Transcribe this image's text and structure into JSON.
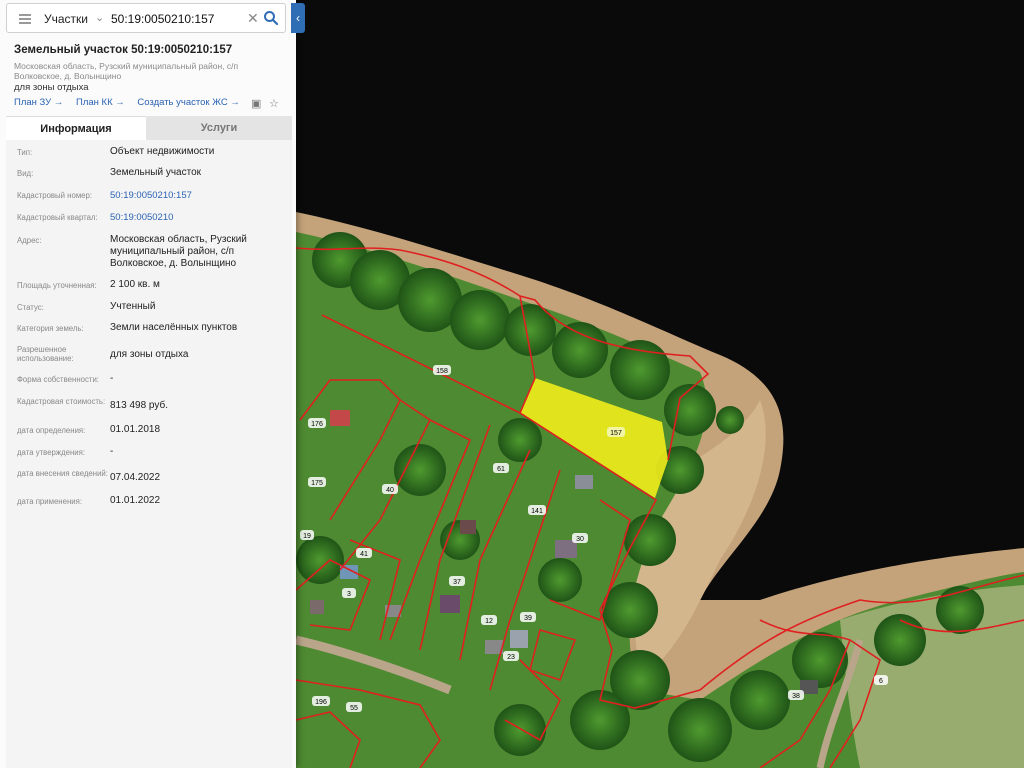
{
  "search": {
    "layer": "Участки",
    "query": "50:19:0050210:157"
  },
  "parcel": {
    "title": "Земельный участок 50:19:0050210:157",
    "address_short": "Московская область, Рузский муниципальный район, с/п Волковское, д. Волынщино",
    "purpose": "для зоны отдыха",
    "links": [
      "План ЗУ",
      "План КК",
      "Создать участок ЖС"
    ]
  },
  "tabs": [
    "Информация",
    "Услуги"
  ],
  "properties": [
    {
      "label": "Тип:",
      "value": "Объект недвижимости"
    },
    {
      "label": "Вид:",
      "value": "Земельный участок"
    },
    {
      "label": "Кадастровый номер:",
      "value": "50:19:0050210:157"
    },
    {
      "label": "Кадастровый квартал:",
      "value": "50:19:0050210"
    },
    {
      "label": "Адрес:",
      "value": "Московская область, Рузский муниципальный район, с/п Волковское, д. Волынщино"
    },
    {
      "label": "Площадь уточненная:",
      "value": "2 100 кв. м"
    },
    {
      "label": "Статус:",
      "value": "Учтенный"
    },
    {
      "label": "Категория земель:",
      "value": "Земли населённых пунктов"
    },
    {
      "label": "Разрешенное использование:",
      "value": "для зоны отдыха"
    },
    {
      "label": "Форма собственности:",
      "value": "-"
    },
    {
      "label": "Кадастровая стоимость:",
      "value": "813 498 руб."
    },
    {
      "label": "дата определения:",
      "value": "01.01.2018"
    },
    {
      "label": "дата утверждения:",
      "value": "-"
    },
    {
      "label": "дата внесения сведений:",
      "value": "07.04.2022"
    },
    {
      "label": "дата применения:",
      "value": "01.01.2022"
    }
  ],
  "map_labels": [
    "158",
    "157",
    "61",
    "141",
    "30",
    "176",
    "175",
    "40",
    "41",
    "37",
    "3",
    "19",
    "12",
    "39",
    "23",
    "196",
    "55",
    "38",
    "6"
  ],
  "colors": {
    "accent": "#2f6db5",
    "parcel_highlight": "#f2ec1c",
    "boundary": "#e02020",
    "water": "#0a0a0a"
  }
}
